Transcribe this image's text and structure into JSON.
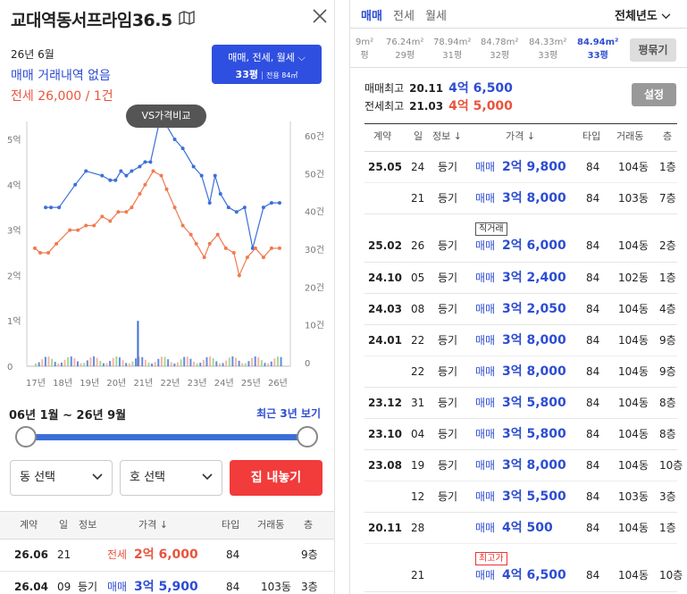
{
  "left": {
    "title": "교대역동서프라임36.5",
    "ym": "26년 6월",
    "no_trade": "매매 거래내역 없음",
    "jeonse": "전세 26,000 / 1건",
    "filter": {
      "line1": "매매, 전세, 월세",
      "line2": "33평",
      "area": "전용 84㎡"
    },
    "vs_button": "VS가격비교",
    "range_label": "06년 1월 ~ 26년 9월",
    "recent_button": "최근 3년 보기",
    "dong_select": "동 선택",
    "ho_select": "호 선택",
    "list_button": "집 내놓기",
    "headers": [
      "계약",
      "일",
      "정보",
      "가격 ↓",
      "타입",
      "거래동",
      "층"
    ],
    "rows": [
      {
        "ym": "26.06",
        "day": "21",
        "info": "",
        "kind": "전세",
        "price": "2억 6,000",
        "type": "84",
        "dong": "",
        "floor": "9층"
      },
      {
        "ym": "26.04",
        "day": "09",
        "info": "등기",
        "kind": "매매",
        "price": "3억 5,900",
        "type": "84",
        "dong": "103동",
        "floor": "3층"
      }
    ]
  },
  "chart_data": {
    "type": "line",
    "x_ticks": [
      "17년",
      "18년",
      "19년",
      "20년",
      "21년",
      "22년",
      "23년",
      "24년",
      "25년",
      "26년"
    ],
    "y_left_ticks": [
      "0",
      "1억",
      "2억",
      "3억",
      "4억",
      "5억"
    ],
    "y_right_ticks": [
      "0",
      "10건",
      "20건",
      "30건",
      "40건",
      "50건",
      "60건"
    ],
    "y_left_range": [
      0,
      5
    ],
    "y_right_range": [
      0,
      60
    ],
    "series": [
      {
        "name": "매매",
        "color": "#3b6fd8",
        "points": [
          [
            17.4,
            3.5
          ],
          [
            17.6,
            3.5
          ],
          [
            17.9,
            3.5
          ],
          [
            18.5,
            4.0
          ],
          [
            18.9,
            4.3
          ],
          [
            19.5,
            4.2
          ],
          [
            19.8,
            4.1
          ],
          [
            20.0,
            4.1
          ],
          [
            20.2,
            4.3
          ],
          [
            20.4,
            4.2
          ],
          [
            20.6,
            4.3
          ],
          [
            20.9,
            4.4
          ],
          [
            21.1,
            4.5
          ],
          [
            21.3,
            4.5
          ],
          [
            21.6,
            5.3
          ],
          [
            21.9,
            5.3
          ],
          [
            22.2,
            5.0
          ],
          [
            22.5,
            4.8
          ],
          [
            22.9,
            4.4
          ],
          [
            23.2,
            4.2
          ],
          [
            23.5,
            3.6
          ],
          [
            23.7,
            4.2
          ],
          [
            23.9,
            3.8
          ],
          [
            24.2,
            3.5
          ],
          [
            24.5,
            3.4
          ],
          [
            24.8,
            3.5
          ],
          [
            25.1,
            2.6
          ],
          [
            25.5,
            3.5
          ],
          [
            25.8,
            3.6
          ],
          [
            26.1,
            3.6
          ]
        ]
      },
      {
        "name": "전세",
        "color": "#f07a50",
        "points": [
          [
            17.0,
            2.6
          ],
          [
            17.2,
            2.5
          ],
          [
            17.5,
            2.5
          ],
          [
            17.8,
            2.7
          ],
          [
            18.3,
            3.0
          ],
          [
            18.6,
            3.0
          ],
          [
            18.9,
            3.1
          ],
          [
            19.2,
            3.1
          ],
          [
            19.5,
            3.3
          ],
          [
            19.8,
            3.2
          ],
          [
            20.1,
            3.4
          ],
          [
            20.4,
            3.4
          ],
          [
            20.6,
            3.5
          ],
          [
            20.9,
            3.8
          ],
          [
            21.1,
            4.0
          ],
          [
            21.4,
            4.3
          ],
          [
            21.7,
            4.2
          ],
          [
            21.9,
            3.9
          ],
          [
            22.2,
            3.5
          ],
          [
            22.5,
            3.1
          ],
          [
            22.8,
            2.9
          ],
          [
            23.0,
            2.7
          ],
          [
            23.3,
            2.4
          ],
          [
            23.5,
            2.7
          ],
          [
            23.8,
            2.9
          ],
          [
            24.1,
            2.6
          ],
          [
            24.4,
            2.5
          ],
          [
            24.6,
            2.0
          ],
          [
            24.9,
            2.4
          ],
          [
            25.2,
            2.6
          ],
          [
            25.5,
            2.4
          ],
          [
            25.8,
            2.6
          ],
          [
            26.1,
            2.6
          ]
        ]
      }
    ],
    "volume_spike_year": 20.8,
    "volume_spike_count": 12
  },
  "right": {
    "tabs": [
      "매매",
      "전세",
      "월세"
    ],
    "year_filter": "전체년도",
    "areas": [
      {
        "m2": "9m²",
        "p": "평"
      },
      {
        "m2": "76.24m²",
        "p": "29평"
      },
      {
        "m2": "78.94m²",
        "p": "31평"
      },
      {
        "m2": "84.78m²",
        "p": "32평"
      },
      {
        "m2": "84.33m²",
        "p": "33평"
      },
      {
        "m2": "84.94m²",
        "p": "33평"
      }
    ],
    "pyeong_button": "평묶기",
    "max_sale": {
      "label": "매매최고",
      "date": "20.11",
      "price": "4억 6,500"
    },
    "max_lease": {
      "label": "전세최고",
      "date": "21.03",
      "price": "4억 5,000"
    },
    "settings": "설정",
    "headers": [
      "계약",
      "일",
      "정보 ↓",
      "가격 ↓",
      "타입",
      "거래동",
      "층"
    ],
    "rows": [
      {
        "ym": "25.05",
        "day": "24",
        "info": "등기",
        "tag": "",
        "price": "2억 9,800",
        "type": "84",
        "dong": "104동",
        "floor": "1층"
      },
      {
        "ym": "",
        "day": "21",
        "info": "등기",
        "tag": "",
        "price": "3억 8,000",
        "type": "84",
        "dong": "103동",
        "floor": "7층"
      },
      {
        "ym": "25.02",
        "day": "26",
        "info": "등기",
        "tag": "직거래",
        "price": "2억 6,000",
        "type": "84",
        "dong": "104동",
        "floor": "2층"
      },
      {
        "ym": "24.10",
        "day": "05",
        "info": "등기",
        "tag": "",
        "price": "3억 2,400",
        "type": "84",
        "dong": "102동",
        "floor": "1층"
      },
      {
        "ym": "24.03",
        "day": "08",
        "info": "등기",
        "tag": "",
        "price": "3억 2,050",
        "type": "84",
        "dong": "104동",
        "floor": "4층"
      },
      {
        "ym": "24.01",
        "day": "22",
        "info": "등기",
        "tag": "",
        "price": "3억 8,000",
        "type": "84",
        "dong": "104동",
        "floor": "9층"
      },
      {
        "ym": "",
        "day": "22",
        "info": "등기",
        "tag": "",
        "price": "3억 8,000",
        "type": "84",
        "dong": "104동",
        "floor": "9층"
      },
      {
        "ym": "23.12",
        "day": "31",
        "info": "등기",
        "tag": "",
        "price": "3억 5,800",
        "type": "84",
        "dong": "104동",
        "floor": "8층"
      },
      {
        "ym": "23.10",
        "day": "04",
        "info": "등기",
        "tag": "",
        "price": "3억 5,800",
        "type": "84",
        "dong": "104동",
        "floor": "8층"
      },
      {
        "ym": "23.08",
        "day": "19",
        "info": "등기",
        "tag": "",
        "price": "3억 8,000",
        "type": "84",
        "dong": "104동",
        "floor": "10층"
      },
      {
        "ym": "",
        "day": "12",
        "info": "등기",
        "tag": "",
        "price": "3억 5,500",
        "type": "84",
        "dong": "103동",
        "floor": "3층"
      },
      {
        "ym": "20.11",
        "day": "28",
        "info": "",
        "tag": "",
        "price": "4억 500",
        "type": "84",
        "dong": "104동",
        "floor": "1층"
      },
      {
        "ym": "",
        "day": "21",
        "info": "",
        "tag": "최고가",
        "price": "4억 6,500",
        "type": "84",
        "dong": "104동",
        "floor": "10층"
      }
    ]
  }
}
